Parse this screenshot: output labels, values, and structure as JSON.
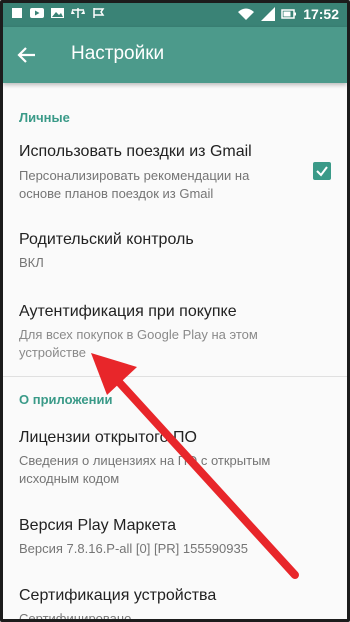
{
  "status_bar": {
    "time": "17:52",
    "icons": [
      "square-notification-icon",
      "youtube-icon",
      "image-icon",
      "scale-icon",
      "check-flag-icon",
      "wifi-icon",
      "signal-icon",
      "battery-icon"
    ]
  },
  "appbar": {
    "title": "Настройки"
  },
  "sections": [
    {
      "header": "Личные"
    },
    {
      "header": "О приложении"
    }
  ],
  "rows": [
    {
      "title": "Использовать поездки из Gmail",
      "subtitle": "Персонализировать рекомендации на основе планов поездок из Gmail",
      "checked": true
    },
    {
      "title": "Родительский контроль",
      "subtitle": "ВКЛ"
    },
    {
      "title": "Аутентификация при покупке",
      "subtitle": "Для всех покупок в Google Play на этом устройстве"
    },
    {
      "title": "Лицензии открытого ПО",
      "subtitle": "Сведения о лицензиях на ПО с открытым исходным кодом"
    },
    {
      "title": "Версия Play Маркета",
      "subtitle": "Версия 7.8.16.P-all [0] [PR] 155590935"
    },
    {
      "title": "Сертификация устройства",
      "subtitle": "Сертифицировано"
    }
  ],
  "colors": {
    "status_bar": "#3a8376",
    "appbar": "#4c9a8b",
    "accent": "#3a9a88",
    "annotation_arrow": "#e8262a"
  }
}
